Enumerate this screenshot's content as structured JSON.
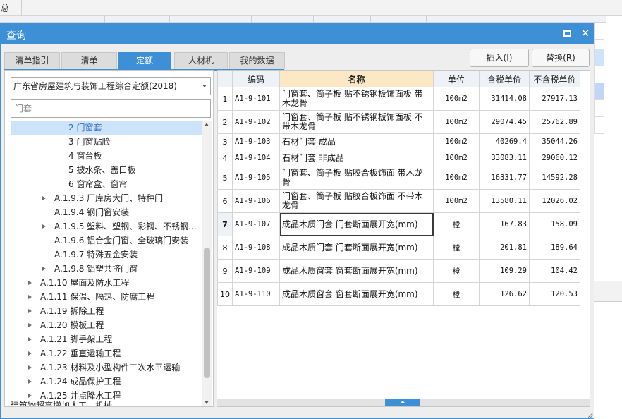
{
  "background": {
    "corner_label": "总"
  },
  "dialog": {
    "title": "查询",
    "tabs": [
      {
        "label": "清单指引",
        "active": false
      },
      {
        "label": "清单",
        "active": false
      },
      {
        "label": "定额",
        "active": true
      },
      {
        "label": "人材机",
        "active": false
      },
      {
        "label": "我的数据",
        "active": false
      }
    ],
    "insert_button": "插入(I)",
    "replace_button": "替换(R)"
  },
  "left": {
    "quota_book": "广东省房屋建筑与装饰工程综合定额(2018)",
    "search_placeholder": "门套",
    "tree": [
      {
        "label": "2 门窗套",
        "level": 3,
        "expandable": false,
        "selected": true
      },
      {
        "label": "3 门窗贴脸",
        "level": 3,
        "expandable": false
      },
      {
        "label": "4 窗台板",
        "level": 3,
        "expandable": false
      },
      {
        "label": "5 披水条、盖口板",
        "level": 3,
        "expandable": false
      },
      {
        "label": "6 窗帘盒、窗帘",
        "level": 3,
        "expandable": false
      },
      {
        "label": "A.1.9.3 厂库房大门、特种门",
        "level": 2,
        "expandable": true
      },
      {
        "label": "A.1.9.4 钢门窗安装",
        "level": 2,
        "expandable": false
      },
      {
        "label": "A.1.9.5 塑料、塑钢、彩钢、不锈钢...",
        "level": 2,
        "expandable": true
      },
      {
        "label": "A.1.9.6 铝合金门窗、全玻璃门安装",
        "level": 2,
        "expandable": false
      },
      {
        "label": "A.1.9.7 特殊五金安装",
        "level": 2,
        "expandable": false
      },
      {
        "label": "A.1.9.8 铝塑共挤门窗",
        "level": 2,
        "expandable": true
      },
      {
        "label": "A.1.10 屋面及防水工程",
        "level": 1,
        "expandable": true
      },
      {
        "label": "A.1.11 保温、隔热、防腐工程",
        "level": 1,
        "expandable": true
      },
      {
        "label": "A.1.19 拆除工程",
        "level": 1,
        "expandable": true
      },
      {
        "label": "A.1.20 模板工程",
        "level": 1,
        "expandable": true
      },
      {
        "label": "A.1.21 脚手架工程",
        "level": 1,
        "expandable": true
      },
      {
        "label": "A.1.22 垂直运输工程",
        "level": 1,
        "expandable": true
      },
      {
        "label": "A.1.23 材料及小型构件二次水平运输",
        "level": 1,
        "expandable": true
      },
      {
        "label": "A.1.24 成品保护工程",
        "level": 1,
        "expandable": true
      },
      {
        "label": "A.1.25 井点降水工程",
        "level": 1,
        "expandable": true
      },
      {
        "label": "建筑物超高增加人工、机械...",
        "level": 0,
        "expandable": false,
        "clipped": true
      }
    ]
  },
  "grid": {
    "columns": [
      "",
      "编码",
      "名称",
      "单位",
      "含税单价",
      "不含税单价"
    ],
    "rows": [
      {
        "no": "1",
        "code": "A1-9-101",
        "name": "门窗套、筒子板 贴不锈钢板饰面板 带木龙骨",
        "unit": "100m2",
        "price_tax": "31414.08",
        "price_notax": "27917.13"
      },
      {
        "no": "2",
        "code": "A1-9-102",
        "name": "门窗套、筒子板 贴不锈钢板饰面板 不带木龙骨",
        "unit": "100m2",
        "price_tax": "29074.45",
        "price_notax": "25762.89"
      },
      {
        "no": "3",
        "code": "A1-9-103",
        "name": "石材门套 成品",
        "unit": "100m2",
        "price_tax": "40269.4",
        "price_notax": "35044.26"
      },
      {
        "no": "4",
        "code": "A1-9-104",
        "name": "石材门套 非成品",
        "unit": "100m2",
        "price_tax": "33083.11",
        "price_notax": "29060.12"
      },
      {
        "no": "5",
        "code": "A1-9-105",
        "name": "门窗套、筒子板 贴胶合板饰面 带木龙骨",
        "unit": "100m2",
        "price_tax": "16331.77",
        "price_notax": "14592.28"
      },
      {
        "no": "6",
        "code": "A1-9-106",
        "name": "门窗套、筒子板 贴胶合板饰面 不带木龙骨",
        "unit": "100m2",
        "price_tax": "13580.11",
        "price_notax": "12026.02"
      },
      {
        "no": "7",
        "code": "A1-9-107",
        "name": "成品木质门套 门套断面展开宽(mm)",
        "unit": "樘",
        "price_tax": "167.83",
        "price_notax": "158.09",
        "current": true
      },
      {
        "no": "8",
        "code": "A1-9-108",
        "name": "成品木质门套 门套断面展开宽(mm)",
        "unit": "樘",
        "price_tax": "201.81",
        "price_notax": "189.64"
      },
      {
        "no": "9",
        "code": "A1-9-109",
        "name": "成品木质窗套 窗套断面展开宽(mm)",
        "unit": "樘",
        "price_tax": "109.29",
        "price_notax": "104.42"
      },
      {
        "no": "10",
        "code": "A1-9-110",
        "name": "成品木质窗套 窗套断面展开宽(mm)",
        "unit": "樘",
        "price_tax": "126.62",
        "price_notax": "120.53"
      }
    ]
  },
  "colors": {
    "accent": "#3d8fd6",
    "name_header": "#fde8c6",
    "selection": "#cde3f9"
  }
}
